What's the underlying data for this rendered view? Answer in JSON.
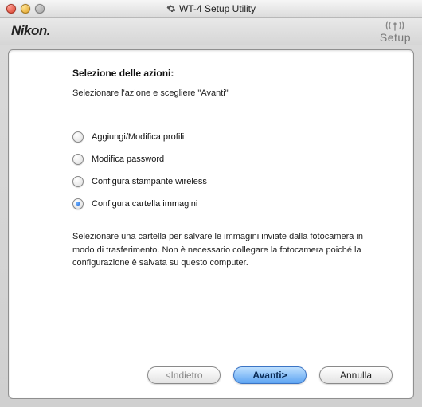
{
  "window": {
    "title": "WT-4 Setup Utility"
  },
  "brand": "Nikon.",
  "setup_label": "Setup",
  "content": {
    "heading": "Selezione delle azioni:",
    "instruction": "Selezionare l'azione e scegliere \"Avanti\"",
    "options": [
      {
        "label": "Aggiungi/Modifica profili",
        "selected": false
      },
      {
        "label": "Modifica password",
        "selected": false
      },
      {
        "label": "Configura stampante wireless",
        "selected": false
      },
      {
        "label": "Configura cartella immagini",
        "selected": true
      }
    ],
    "description": "Selezionare una cartella per salvare le immagini inviate dalla fotocamera in modo di trasferimento. Non è necessario collegare la fotocamera poiché la configurazione è salvata su questo computer."
  },
  "buttons": {
    "back": "<Indietro",
    "next": "Avanti>",
    "cancel": "Annulla"
  }
}
